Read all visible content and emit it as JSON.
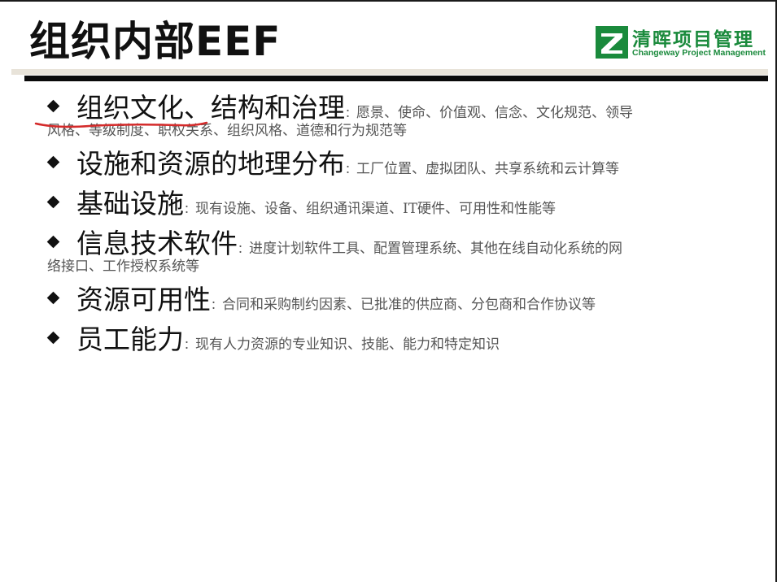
{
  "slide": {
    "title": "组织内部EEF"
  },
  "logo": {
    "name_cn": "清晖项目管理",
    "name_en": "Changeway Project Management",
    "brand_color": "#1a8a3c"
  },
  "items": [
    {
      "head": "组织文化、结构和治理",
      "desc": "愿景、使命、价值观、信念、文化规范、领导",
      "desc_cont": "风格、等级制度、职权关系、组织风格、道德和行为规范等"
    },
    {
      "head": "设施和资源的地理分布",
      "desc": "工厂位置、虚拟团队、共享系统和云计算等"
    },
    {
      "head": "基础设施",
      "desc": "现有设施、设备、组织通讯渠道、IT硬件、可用性和性能等"
    },
    {
      "head": "信息技术软件",
      "desc": "进度计划软件工具、配置管理系统、其他在线自动化系统的网",
      "desc_cont": "络接口、工作授权系统等"
    },
    {
      "head": "资源可用性",
      "desc": "合同和采购制约因素、已批准的供应商、分包商和合作协议等"
    },
    {
      "head": "员工能力",
      "desc": "现有人力资源的专业知识、技能、能力和特定知识"
    }
  ],
  "punctuation": {
    "colon": "："
  },
  "annotation": {
    "color": "#d42a2a"
  }
}
